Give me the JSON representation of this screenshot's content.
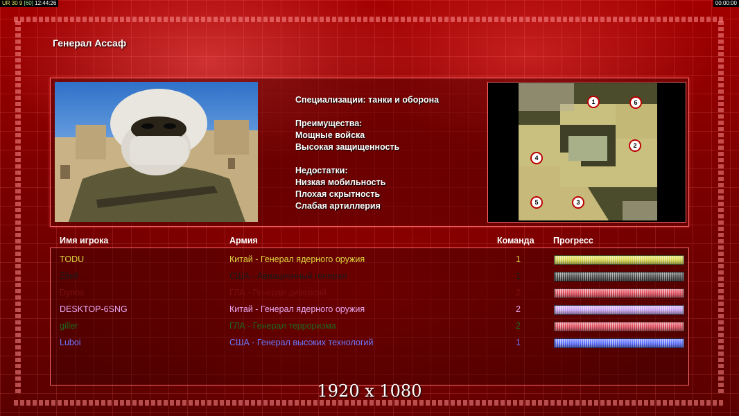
{
  "topbar": {
    "status_left": "UR 30 9",
    "fps": "[60]",
    "clock": "12:44:26",
    "status_right": "00:00:00"
  },
  "general": {
    "title": "Генерал Ассаф"
  },
  "description": {
    "specialization": "Специализации: танки и оборона",
    "advantages_header": "Преимущества:",
    "advantages": [
      "Мощные войска",
      "Высокая защищенность"
    ],
    "disadvantages_header": "Недостатки:",
    "disadvantages": [
      "Низкая мобильность",
      "Плохая скрытность",
      "Слабая артиллерия"
    ]
  },
  "map": {
    "spawn_points": [
      "1",
      "2",
      "3",
      "4",
      "5",
      "6"
    ]
  },
  "table": {
    "headers": {
      "player": "Имя игрока",
      "army": "Армия",
      "team": "Команда",
      "progress": "Прогресс"
    },
    "rows": [
      {
        "name": "TODU",
        "army": "Китай - Генерал ядерного оружия",
        "team": "1",
        "color": "#e0d840",
        "progress_color": "#d8d84a"
      },
      {
        "name": "Zitell",
        "army": "США - Авиационный генерал",
        "team": "1",
        "color": "#1a1a1a",
        "progress_color": "#4a4a4a"
      },
      {
        "name": "Dynos",
        "army": "ГЛА - Генерал диверсий",
        "team": "2",
        "color": "#7a1010",
        "progress_color": "#e04a5a"
      },
      {
        "name": "DESKTOP-6SNG",
        "army": "Китай - Генерал ядерного оружия",
        "team": "2",
        "color": "#e8a8f0",
        "progress_color": "#c9a0f0"
      },
      {
        "name": "giller",
        "army": "ГЛА - Генерал терроризма",
        "team": "2",
        "color": "#1d6a1d",
        "progress_color": "#e04a5a"
      },
      {
        "name": "Luboi",
        "army": "США - Генерал высоких технологий",
        "team": "1",
        "color": "#6a78ff",
        "progress_color": "#5a6cff"
      }
    ]
  },
  "resolution": "1920 x 1080",
  "colors": {
    "panel_border": "#ff6a6a",
    "background": "#8a0000"
  }
}
